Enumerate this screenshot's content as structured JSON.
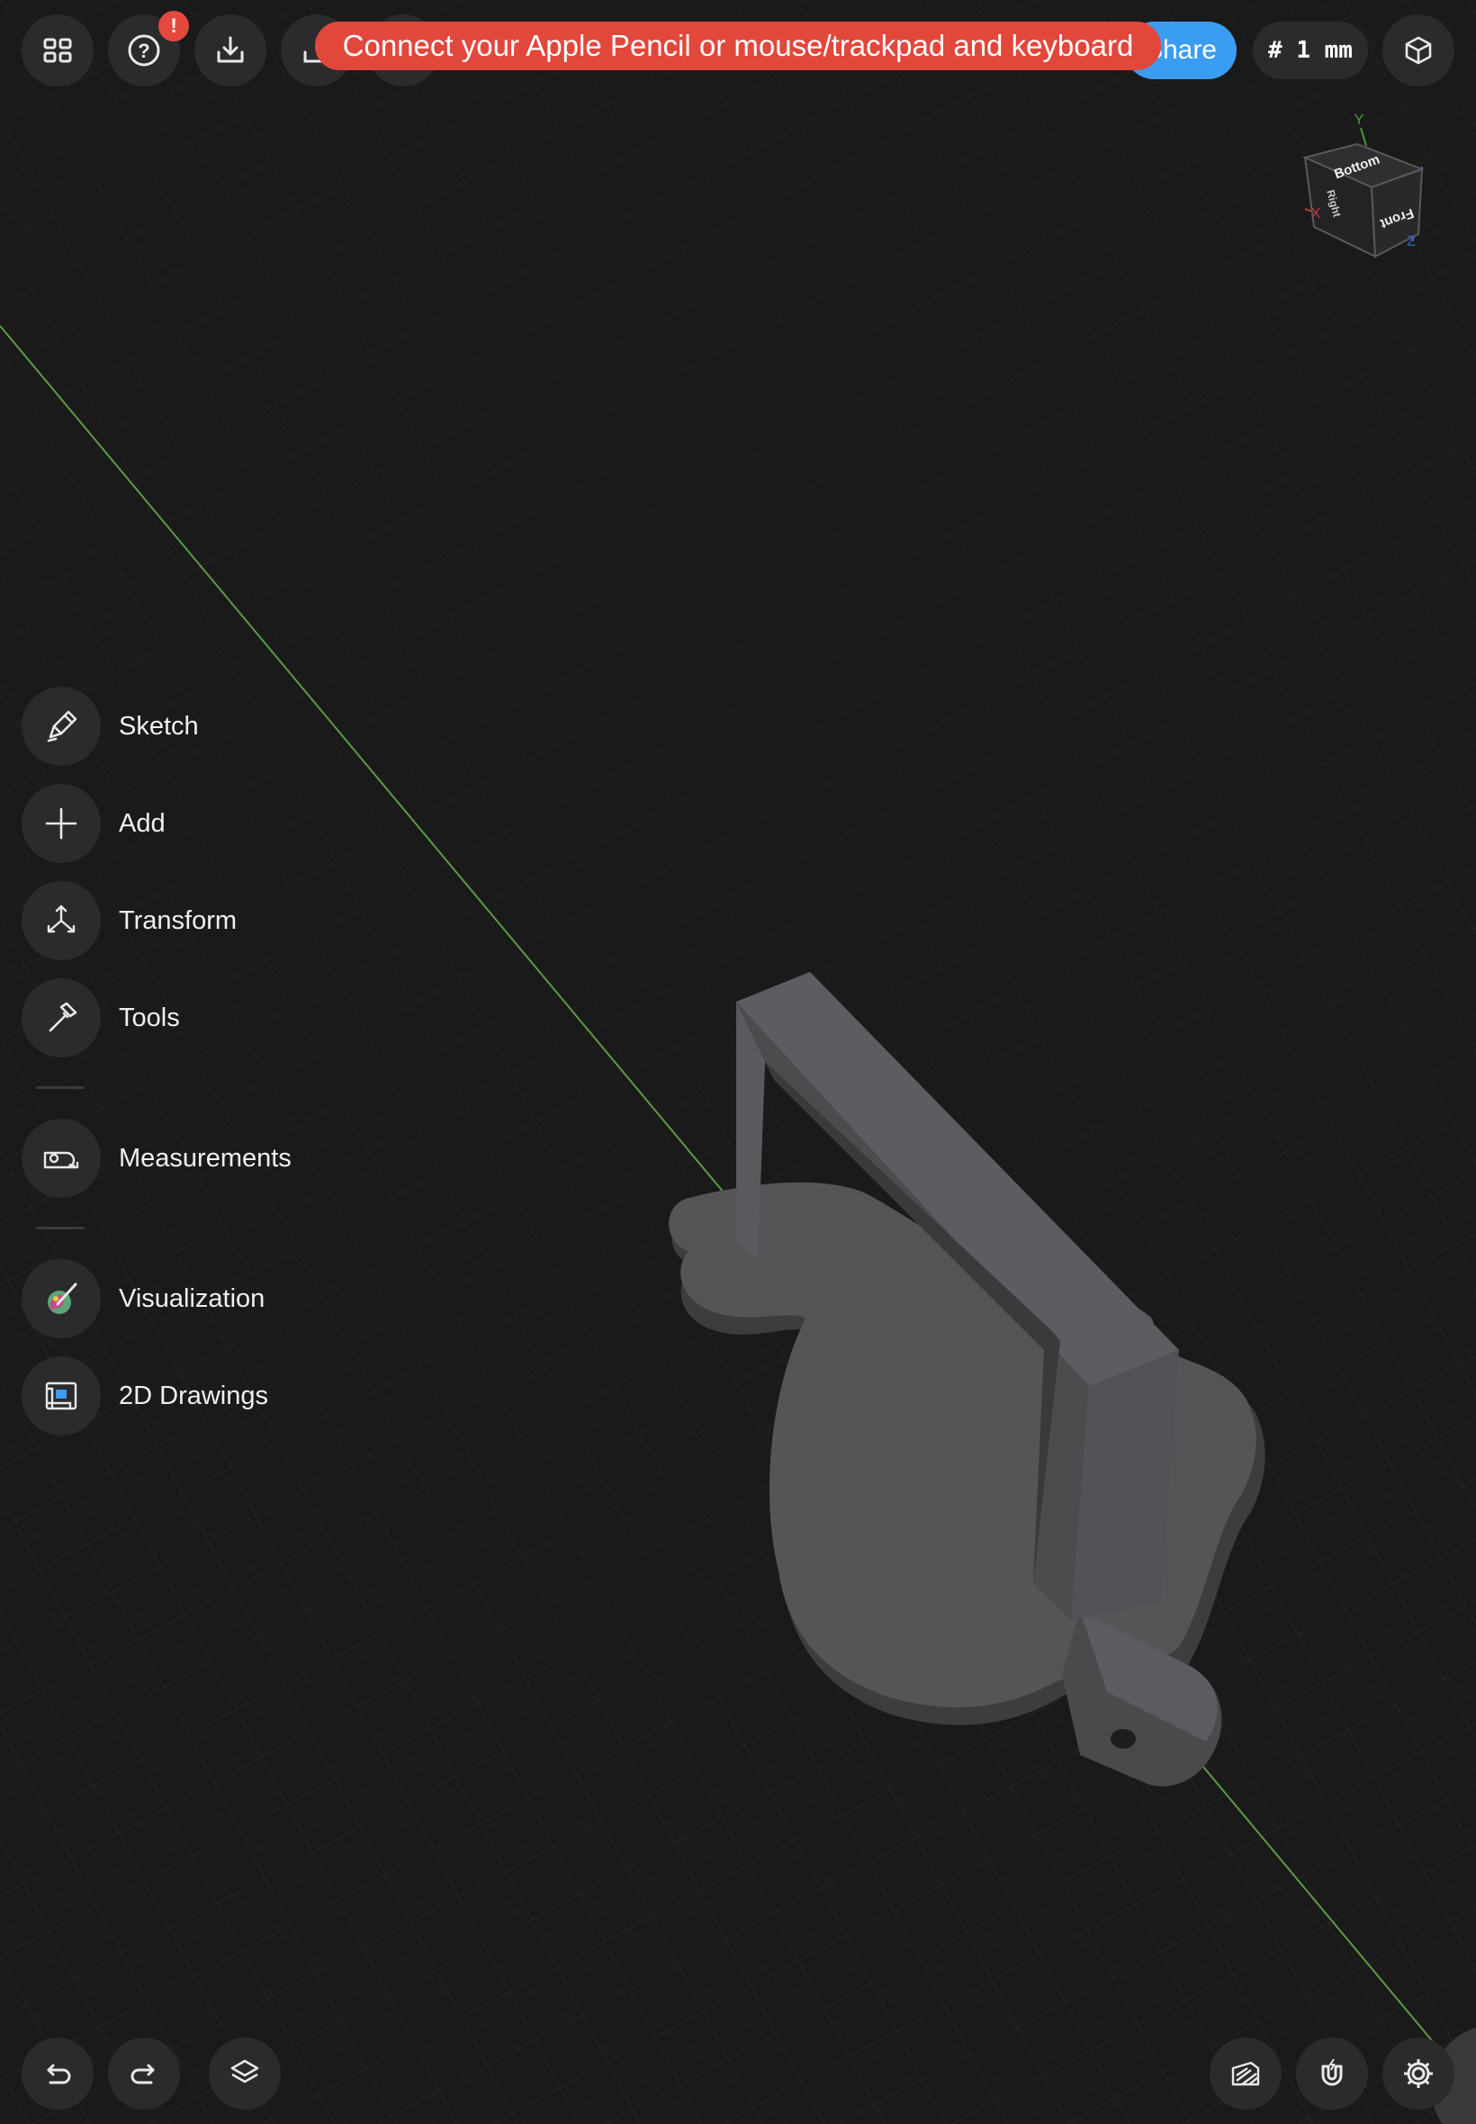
{
  "toolbar": {
    "alert_badge": "!",
    "share_label": "Share",
    "units_label": "# 1 mm"
  },
  "toast": {
    "message": "Connect your Apple Pencil or mouse/trackpad and keyboard"
  },
  "view_cube": {
    "face_top": "Bottom",
    "face_front": "Front",
    "face_side": "Right",
    "axis_x": "X",
    "axis_y": "Y",
    "axis_z": "Z"
  },
  "menu": {
    "items": [
      {
        "label": "Sketch",
        "icon": "pen-icon"
      },
      {
        "label": "Add",
        "icon": "plus-icon"
      },
      {
        "label": "Transform",
        "icon": "transform-icon"
      },
      {
        "label": "Tools",
        "icon": "hammer-icon"
      },
      {
        "label": "Measurements",
        "icon": "tape-measure-icon"
      },
      {
        "label": "Visualization",
        "icon": "palette-icon"
      },
      {
        "label": "2D Drawings",
        "icon": "drawing-sheet-icon"
      }
    ]
  },
  "colors": {
    "background": "#1a1a1b",
    "button": "#2b2b2d",
    "accent_blue": "#3b9df2",
    "toast_red": "#e2473c",
    "axis_green": "#5c9a46",
    "model_gray": "#4f4f52"
  }
}
